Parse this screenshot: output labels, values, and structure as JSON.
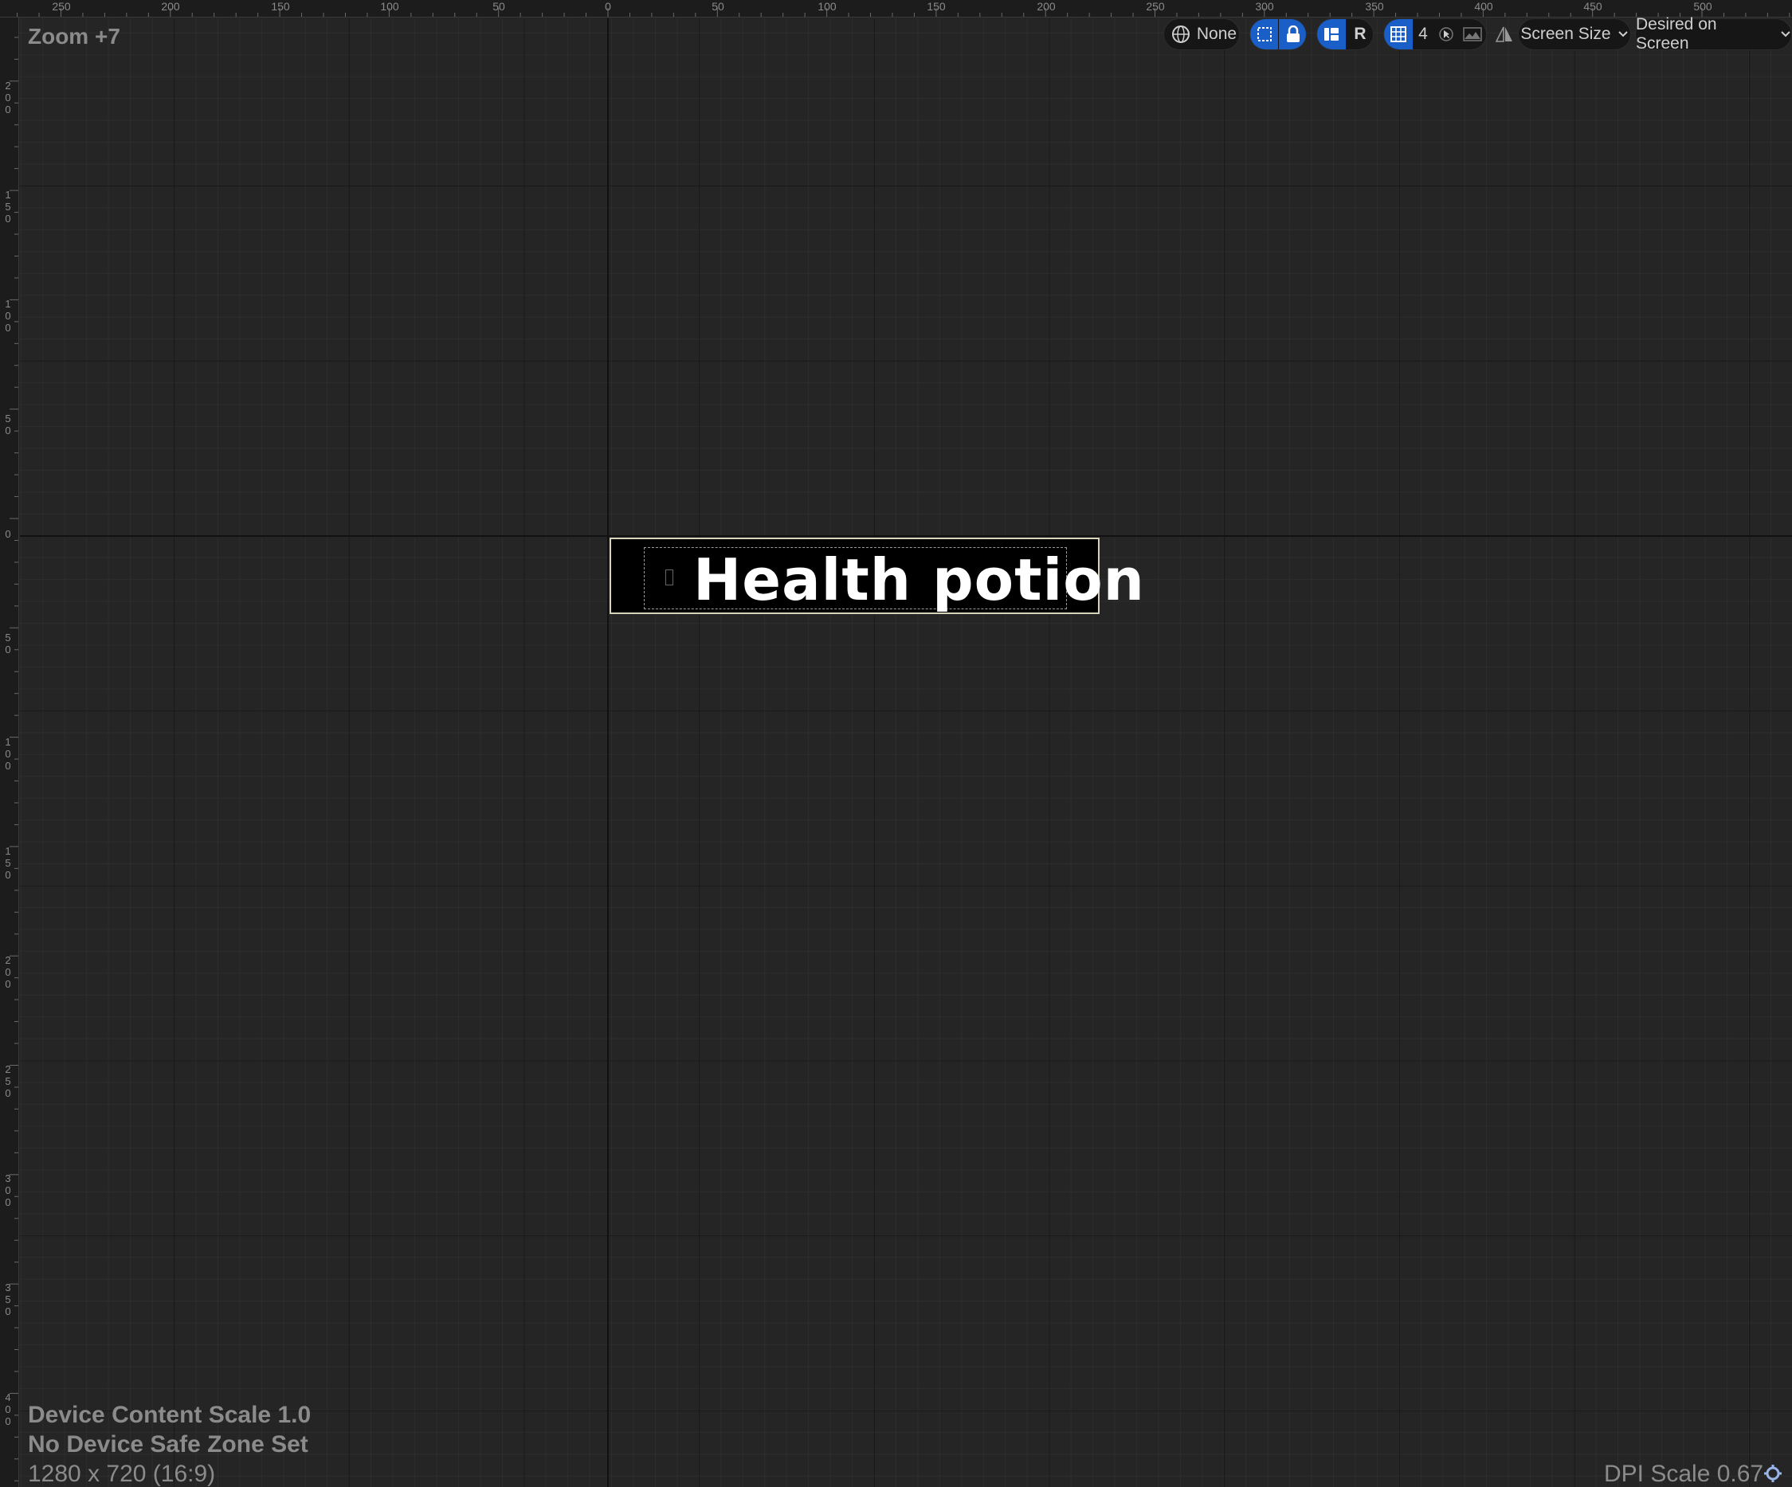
{
  "viewport": {
    "zoom_label": "Zoom +7",
    "device_content_scale": "Device Content Scale 1.0",
    "safe_zone": "No Device Safe Zone Set",
    "resolution": "1280 x 720 (16:9)",
    "dpi_scale": "DPI Scale 0.67"
  },
  "ruler_top": {
    "labels": [
      "250",
      "200",
      "150",
      "100",
      "50",
      "0",
      "50",
      "100",
      "150",
      "200",
      "250",
      "300",
      "350",
      "400",
      "450",
      "500"
    ]
  },
  "ruler_left": {
    "labels": [
      "200",
      "150",
      "100",
      "50",
      "0",
      "50",
      "100",
      "150",
      "200",
      "250",
      "300",
      "350",
      "400"
    ]
  },
  "toolbar": {
    "world_label": "None",
    "r_label": "R",
    "grid_snap_value": "4",
    "screen_size_label": "Screen Size",
    "desired_label": "Desired on Screen"
  },
  "widget": {
    "text": "Health potion"
  },
  "colors": {
    "background": "#242424",
    "accent": "#1a5fc8",
    "widget_border": "#d8d2b8"
  }
}
